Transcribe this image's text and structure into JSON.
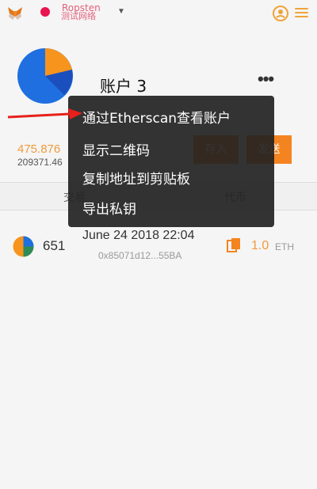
{
  "header": {
    "network_name": "Ropsten",
    "network_sub": "测试网络",
    "icons": {
      "logo": "metamask-fox-icon",
      "account": "account-switch-icon",
      "menu": "hamburger-menu-icon"
    }
  },
  "account": {
    "name": "账户 3",
    "balance_eth": "475.876",
    "balance_usd": "209371.46",
    "deposit_label": "存入",
    "send_label": "发送"
  },
  "tabs": {
    "transactions": "交易",
    "tokens": "代币"
  },
  "transactions": [
    {
      "nonce": "651",
      "date": "June 24 2018 22:04",
      "hash": "0x85071d12...55BA",
      "amount": "1.0",
      "unit": "ETH"
    }
  ],
  "dropdown": {
    "items": [
      "通过Etherscan查看账户",
      "显示二维码",
      "复制地址到剪贴板",
      "导出私钥"
    ]
  },
  "colors": {
    "accent": "#f4841f",
    "network_dot": "#e91550",
    "overlay": "#222222"
  }
}
